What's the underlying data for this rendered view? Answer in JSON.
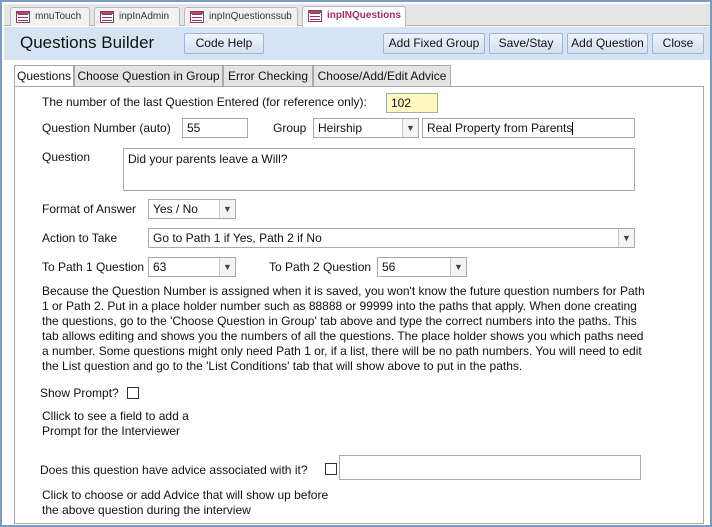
{
  "doc_tabs": [
    {
      "label": "mnuTouch"
    },
    {
      "label": "inpInAdmin"
    },
    {
      "label": "inpInQuestionssub"
    },
    {
      "label": "inpINQuestions"
    }
  ],
  "header": {
    "title": "Questions Builder",
    "code_help": "Code Help",
    "add_fixed_group": "Add Fixed Group",
    "save_stay": "Save/Stay",
    "add_question": "Add Question",
    "close": "Close"
  },
  "form_tabs": [
    {
      "label": "Questions"
    },
    {
      "label": "Choose Question in Group"
    },
    {
      "label": "Error Checking"
    },
    {
      "label": "Choose/Add/Edit Advice"
    }
  ],
  "form": {
    "last_question_label": "The number of the last Question Entered (for reference only):",
    "last_question_value": "102",
    "question_number_label": "Question Number (auto)",
    "question_number_value": "55",
    "group_label": "Group",
    "group_value": "Heirship",
    "group_description": "Real Property from Parents",
    "question_label": "Question",
    "question_value": "Did your parents leave a Will?",
    "format_label": "Format of Answer",
    "format_value": "Yes / No",
    "action_label": "Action to Take",
    "action_value": "Go to Path 1 if Yes, Path 2 if No",
    "path1_label": "To Path 1 Question",
    "path1_value": "63",
    "path2_label": "To Path 2 Question",
    "path2_value": "56",
    "explanation": [
      "Because the Question Number is assigned when it is saved, you won't know the future question numbers for Path",
      "1 or Path 2. Put in a place holder number such as 88888 or 99999 into the paths that apply. When done creating",
      "the questions, go to the 'Choose Question in Group' tab above and type the correct numbers into the paths. This",
      "tab allows editing and shows you the numbers of all the questions. The place holder shows you which paths need",
      "a number. Some questions might only need Path 1 or, if a list, there will be no path numbers. You will need to edit",
      "the List question and go to the 'List Conditions' tab that will show above to put in the paths."
    ],
    "show_prompt_label": "Show Prompt?",
    "show_prompt_hint_1": "Cllick to see a field to add a",
    "show_prompt_hint_2": "Prompt for the Interviewer",
    "advice_label": "Does this question have advice associated with it?",
    "advice_value": "",
    "advice_hint_1": "Click to choose or add Advice that will show up before",
    "advice_hint_2": "the above question during the interview"
  },
  "colors": {
    "header_bg": "#d6e3f3",
    "highlight_field": "#fff8c0",
    "active_doc_tab_text": "#a03060"
  }
}
